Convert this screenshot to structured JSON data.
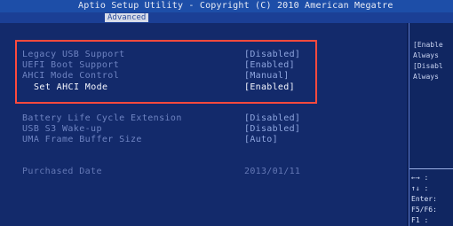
{
  "header": {
    "title": "Aptio Setup Utility - Copyright (C) 2010 American Megatre"
  },
  "tabs": [
    {
      "label": "Advanced",
      "active": true
    }
  ],
  "settings": [
    {
      "label": "Legacy USB Support",
      "value": "[Disabled]"
    },
    {
      "label": "UEFI Boot Support",
      "value": "[Enabled]"
    },
    {
      "label": "AHCI Mode Control",
      "value": "[Manual]"
    },
    {
      "label": "Set AHCI Mode",
      "value": "[Enabled]",
      "selected": true
    },
    {
      "label": "Battery Life Cycle Extension",
      "value": "[Disabled]"
    },
    {
      "label": "USB S3 Wake-up",
      "value": "[Disabled]"
    },
    {
      "label": "UMA Frame Buffer Size",
      "value": "[Auto]"
    },
    {
      "label": "Purchased Date",
      "value": "2013/01/11"
    }
  ],
  "help": {
    "lines": [
      "[Enable",
      "Always",
      "[Disabl",
      "Always"
    ]
  },
  "keys": {
    "lines": [
      "←→  :",
      "↑↓  :",
      "Enter:",
      "F5/F6:",
      "F1   :"
    ]
  },
  "colors": {
    "background": "#132a6b",
    "title_bar": "#1d4ea8",
    "active_tab": "#d7dce8",
    "highlight_box": "#ff4a3d",
    "selected_text": "#f5f7ff"
  }
}
